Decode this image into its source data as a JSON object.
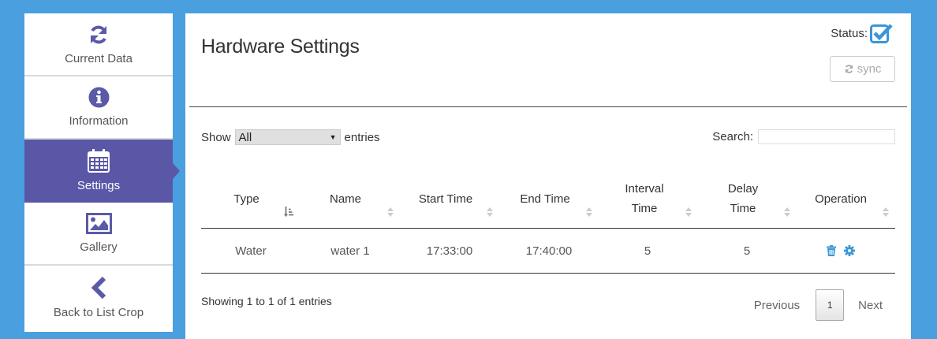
{
  "sidebar": {
    "items": [
      {
        "label": "Current Data",
        "icon": "refresh-icon"
      },
      {
        "label": "Information",
        "icon": "info-circle-icon"
      },
      {
        "label": "Settings",
        "icon": "calendar-icon"
      },
      {
        "label": "Gallery",
        "icon": "image-icon"
      },
      {
        "label": "Back to List Crop",
        "icon": "chevron-left-icon"
      }
    ],
    "active_index": 2
  },
  "main": {
    "title": "Hardware Settings",
    "status_label": "Status:",
    "status_checked": true,
    "sync_label": "sync",
    "show_label": "Show",
    "show_value": "All",
    "entries_label": "entries",
    "search_label": "Search:",
    "search_value": ""
  },
  "table": {
    "headers": [
      {
        "line1": "Type",
        "line2": ""
      },
      {
        "line1": "Name",
        "line2": ""
      },
      {
        "line1": "Start Time",
        "line2": ""
      },
      {
        "line1": "End Time",
        "line2": ""
      },
      {
        "line1": "Interval",
        "line2": "Time"
      },
      {
        "line1": "Delay",
        "line2": "Time"
      },
      {
        "line1": "Operation",
        "line2": ""
      }
    ],
    "rows": [
      {
        "type": "Water",
        "name": "water 1",
        "start": "17:33:00",
        "end": "17:40:00",
        "interval": "5",
        "delay": "5"
      }
    ]
  },
  "footer": {
    "info": "Showing 1 to 1 of 1 entries",
    "previous": "Previous",
    "current_page": "1",
    "next": "Next"
  },
  "colors": {
    "background": "#4a9fdf",
    "sidebar_active": "#5a57a6",
    "icon_purple": "#5a5aa8",
    "action_blue": "#3a96d8"
  }
}
